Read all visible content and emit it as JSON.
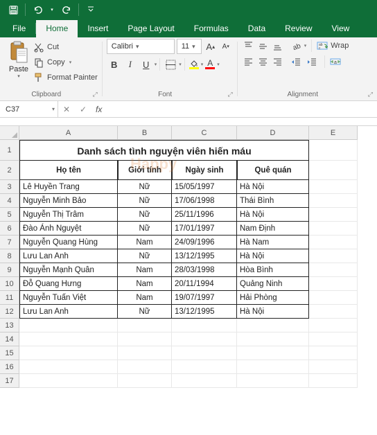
{
  "titlebar": {
    "save_icon": "save",
    "undo_icon": "undo",
    "redo_icon": "redo",
    "customize_icon": "chev-down"
  },
  "tabs": {
    "file": "File",
    "home": "Home",
    "insert": "Insert",
    "page_layout": "Page Layout",
    "formulas": "Formulas",
    "data": "Data",
    "review": "Review",
    "view": "View"
  },
  "ribbon": {
    "clipboard": {
      "paste": "Paste",
      "cut": "Cut",
      "copy": "Copy",
      "format_painter": "Format Painter",
      "group": "Clipboard"
    },
    "font": {
      "name": "Calibri",
      "size": "11",
      "group": "Font",
      "fill_color": "#ffff00",
      "font_color": "#ff0000"
    },
    "alignment": {
      "group": "Alignment",
      "wrap": "Wrap"
    }
  },
  "formula_bar": {
    "name_box": "C37",
    "value": ""
  },
  "sheet": {
    "title": "Danh sách tình nguyện viên hiến máu",
    "headers": {
      "a": "Họ tên",
      "b": "Giới tính",
      "c": "Ngày sinh",
      "d": "Quê quán"
    },
    "rows": [
      {
        "a": "Lê Huyền Trang",
        "b": "Nữ",
        "c": "15/05/1997",
        "d": "Hà Nội"
      },
      {
        "a": "Nguyễn Minh Bảo",
        "b": "Nữ",
        "c": "17/06/1998",
        "d": "Thái Bình"
      },
      {
        "a": "Nguyễn Thị Trâm",
        "b": "Nữ",
        "c": "25/11/1996",
        "d": "Hà Nội"
      },
      {
        "a": "Đào Ánh Nguyệt",
        "b": "Nữ",
        "c": "17/01/1997",
        "d": "Nam Định"
      },
      {
        "a": "Nguyễn Quang Hùng",
        "b": "Nam",
        "c": "24/09/1996",
        "d": "Hà Nam"
      },
      {
        "a": "Lưu Lan Anh",
        "b": "Nữ",
        "c": "13/12/1995",
        "d": "Hà Nội"
      },
      {
        "a": "Nguyễn Mạnh Quân",
        "b": "Nam",
        "c": "28/03/1998",
        "d": "Hòa Bình"
      },
      {
        "a": "Đỗ Quang Hưng",
        "b": "Nam",
        "c": "20/11/1994",
        "d": "Quảng Ninh"
      },
      {
        "a": "Nguyễn Tuấn Việt",
        "b": "Nam",
        "c": "19/07/1997",
        "d": "Hải Phòng"
      },
      {
        "a": "Lưu Lan Anh",
        "b": "Nữ",
        "c": "13/12/1995",
        "d": "Hà Nội"
      }
    ],
    "columns": [
      "A",
      "B",
      "C",
      "D",
      "E"
    ],
    "row_numbers": [
      "1",
      "2",
      "3",
      "4",
      "5",
      "6",
      "7",
      "8",
      "9",
      "10",
      "11",
      "12",
      "13",
      "14",
      "15",
      "16",
      "17"
    ],
    "watermark": "Happy"
  }
}
